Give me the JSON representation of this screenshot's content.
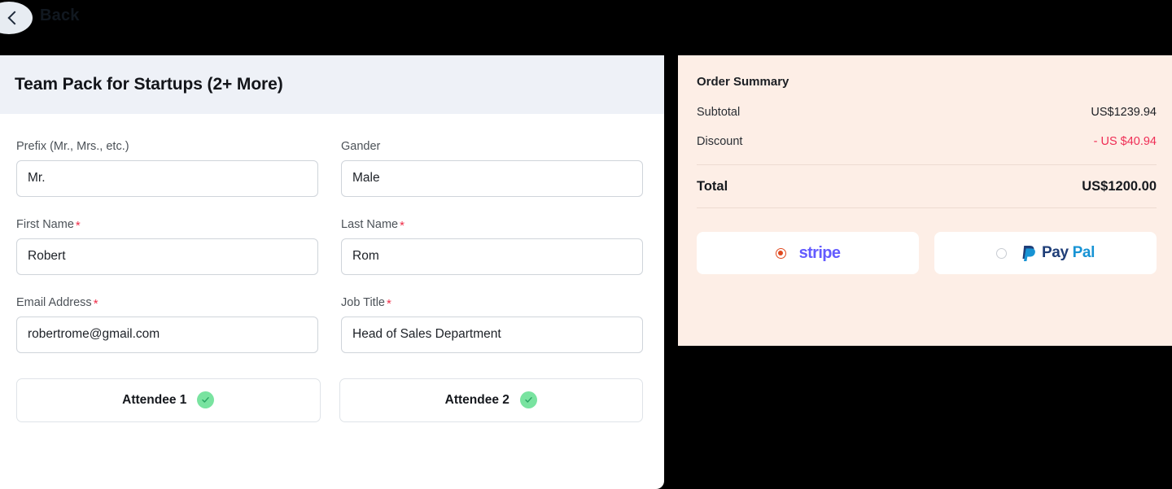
{
  "topbar": {
    "back_label": "Back",
    "back_icon": "chevron-left-icon"
  },
  "form": {
    "title": "Team Pack for Startups (2+ More)",
    "rows": [
      {
        "fields": [
          {
            "label": "Prefix (Mr., Mrs., etc.)",
            "required": false,
            "value": "Mr."
          },
          {
            "label": "Gander",
            "required": false,
            "value": "Male"
          }
        ]
      },
      {
        "fields": [
          {
            "label": "First Name",
            "required": true,
            "value": "Robert"
          },
          {
            "label": "Last Name",
            "required": true,
            "value": "Rom"
          }
        ]
      },
      {
        "fields": [
          {
            "label": "Email Address",
            "required": true,
            "value": "robertrome@gmail.com"
          },
          {
            "label": "Job Title",
            "required": true,
            "value": "Head of Sales Department"
          }
        ]
      }
    ],
    "required_marker": "*",
    "attendees": [
      {
        "label": "Attendee 1",
        "status_icon": "check-circle-icon",
        "complete": true
      },
      {
        "label": "Attendee 2",
        "status_icon": "check-circle-icon",
        "complete": true
      }
    ]
  },
  "order_summary": {
    "title": "Order Summary",
    "lines": [
      {
        "label": "Subtotal",
        "amount": "US$1239.94",
        "negative": false
      },
      {
        "label": "Discount",
        "amount": "- US $40.94",
        "negative": true
      }
    ],
    "total": {
      "label": "Total",
      "amount": "US$1200.00"
    },
    "payment_methods": [
      {
        "id": "stripe",
        "label": "stripe",
        "selected": true,
        "icon": "stripe-logo"
      },
      {
        "id": "paypal",
        "label_part1": "Pay",
        "label_part2": "Pal",
        "selected": false,
        "icon": "paypal-logo"
      }
    ]
  },
  "colors": {
    "page_background": "#000000",
    "form_header": "#eef1f7",
    "order_panel": "#fdeee6",
    "accent_red": "#ef2d55",
    "required_star": "#ef2d48",
    "stripe_purple": "#635bff",
    "paypal_dark": "#1f3e78",
    "paypal_light": "#1793d4",
    "radio_selected": "#e0491f",
    "check_green": "#79e3a0"
  }
}
